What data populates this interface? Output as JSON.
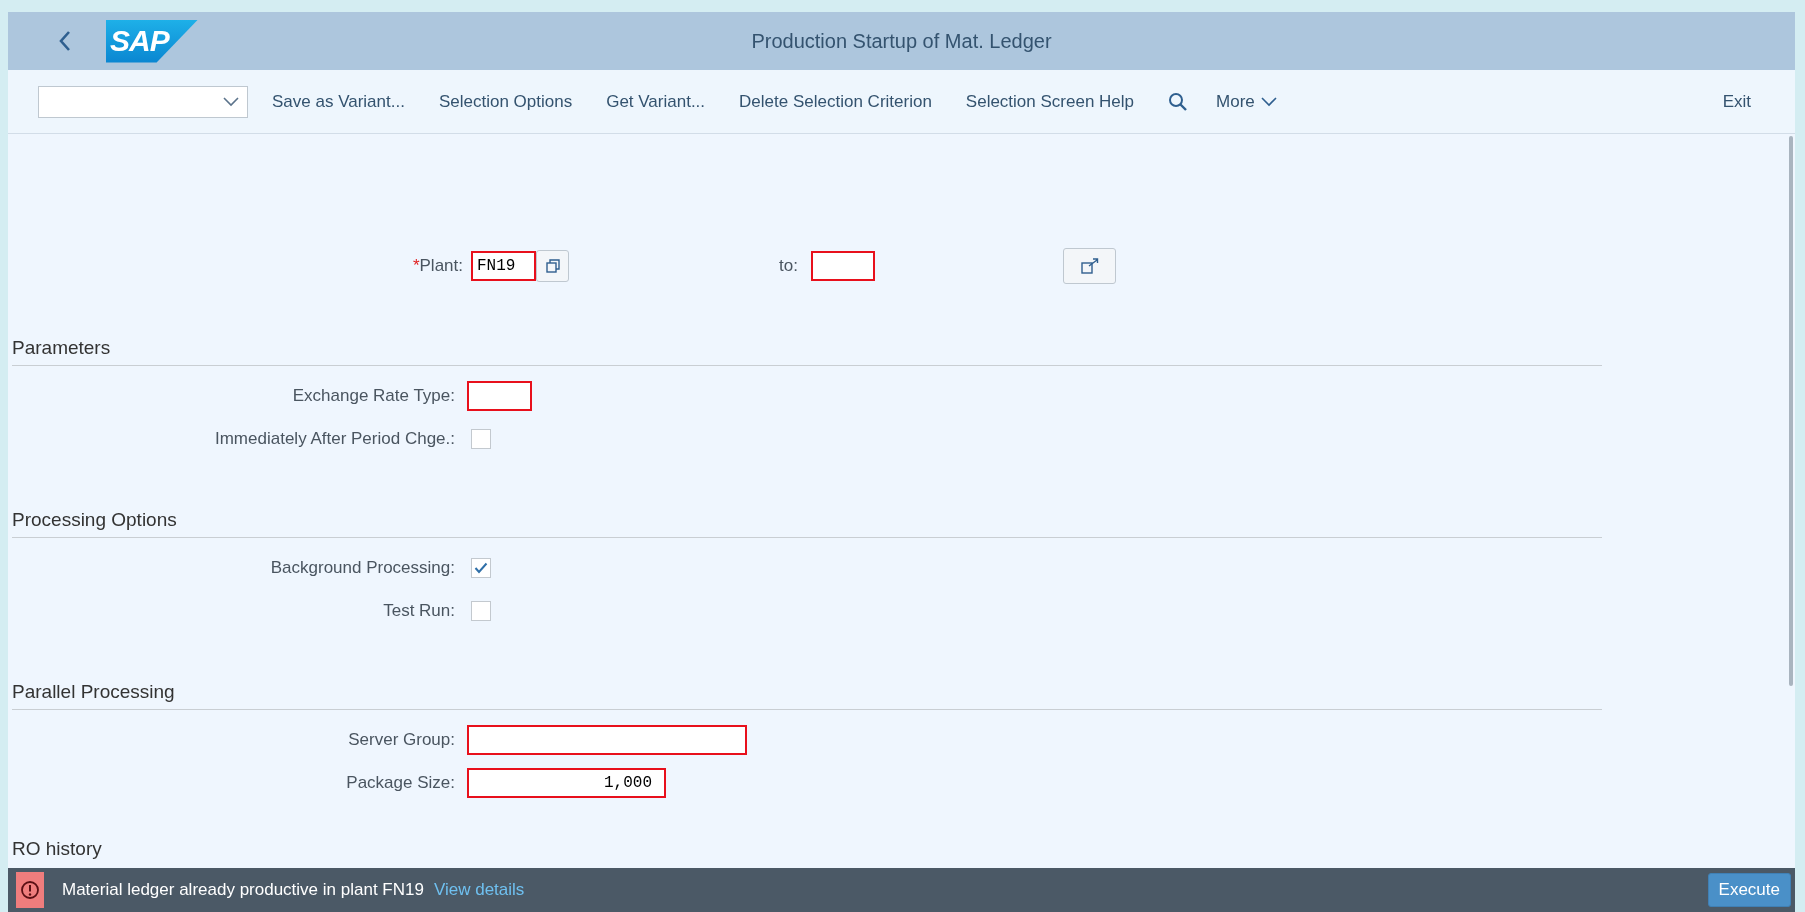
{
  "header": {
    "logo": "SAP",
    "title": "Production Startup of Mat. Ledger"
  },
  "toolbar": {
    "items": [
      "Save as Variant...",
      "Selection Options",
      "Get Variant...",
      "Delete Selection Criterion",
      "Selection Screen Help"
    ],
    "more": "More",
    "exit": "Exit"
  },
  "plant": {
    "label": "Plant:",
    "required_mark": "*",
    "value": "FN19",
    "to_label": "to:"
  },
  "sections": [
    {
      "title": "Parameters",
      "rows": [
        {
          "kind": "short",
          "label": "Exchange Rate Type:"
        },
        {
          "kind": "checkbox",
          "label": "Immediately After Period Chge.:",
          "checked": false
        }
      ]
    },
    {
      "title": "Processing Options",
      "rows": [
        {
          "kind": "checkbox",
          "label": "Background Processing:",
          "checked": true
        },
        {
          "kind": "checkbox",
          "label": "Test Run:",
          "checked": false
        }
      ]
    },
    {
      "title": "Parallel Processing",
      "rows": [
        {
          "kind": "wide",
          "label": "Server Group:"
        },
        {
          "kind": "number",
          "label": "Package Size:",
          "value": "1,000"
        }
      ]
    }
  ],
  "cut_section": "RO history",
  "message": {
    "text": "Material ledger already productive in plant FN19",
    "link": "View details"
  },
  "execute": "Execute"
}
